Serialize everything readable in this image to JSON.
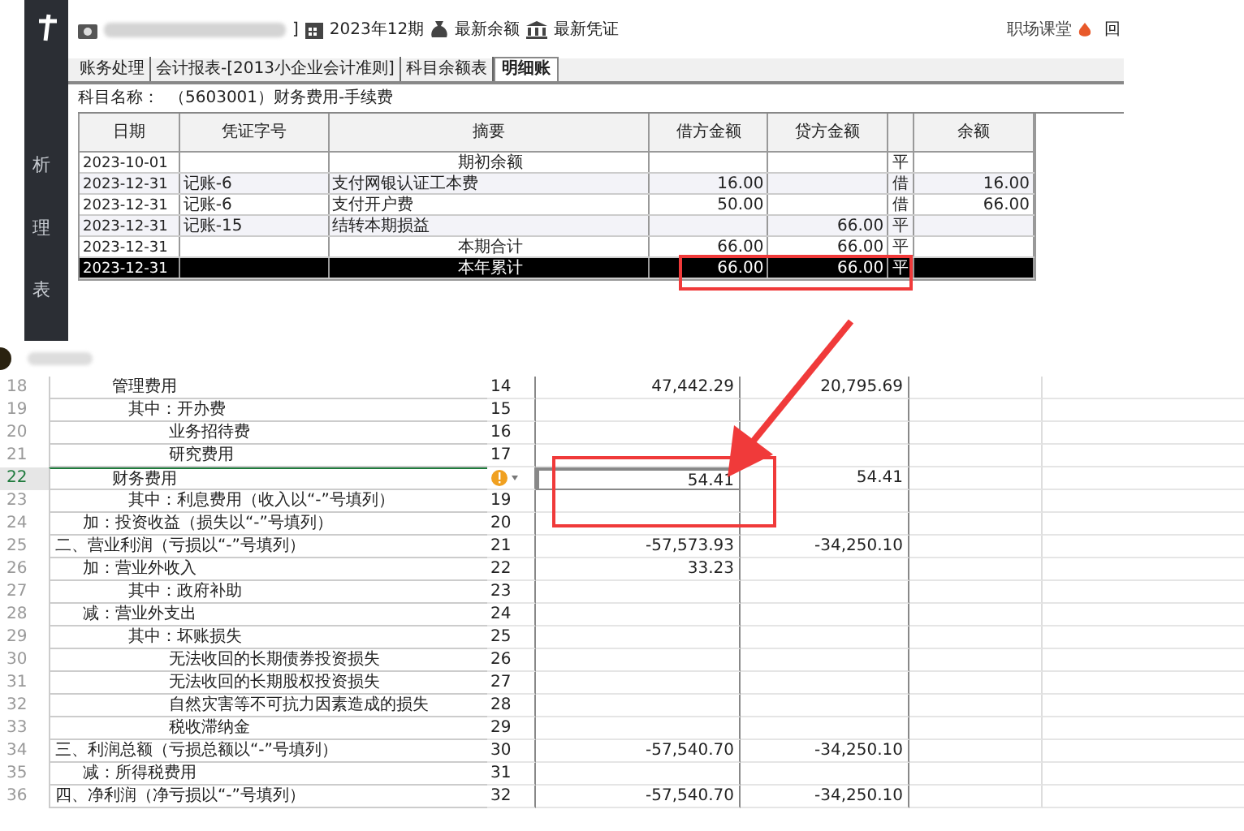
{
  "top_app": {
    "toolbar": {
      "bracket": "]",
      "period": "2023年12期",
      "latest_balance": "最新余额",
      "latest_voucher": "最新凭证",
      "brand": "职场课堂",
      "cut_text": "回"
    },
    "sidebar": {
      "items": [
        "析",
        "理",
        "表"
      ]
    },
    "tabs": [
      {
        "label": "账务处理",
        "selected": false
      },
      {
        "label": "会计报表-[2013小企业会计准则]",
        "selected": false
      },
      {
        "label": "科目余额表",
        "selected": false
      },
      {
        "label": "明细账",
        "selected": true
      }
    ],
    "subject": {
      "label": "科目名称：",
      "value": "（5603001）财务费用-手续费"
    },
    "table": {
      "columns": [
        "日期",
        "凭证字号",
        "摘要",
        "借方金额",
        "贷方金额",
        "余额"
      ],
      "rows": [
        {
          "kind": "total",
          "date": "2023-10-01",
          "summary": "期初余额",
          "direction": "平",
          "selected": false
        },
        {
          "kind": "entry",
          "date": "2023-12-31",
          "voucher": "记账-6",
          "summary": "支付网银认证工本费",
          "debit": "16.00",
          "direction": "借",
          "balance": "16.00",
          "selected": false
        },
        {
          "kind": "entry",
          "date": "2023-12-31",
          "voucher": "记账-6",
          "summary": "支付开户费",
          "debit": "50.00",
          "direction": "借",
          "balance": "66.00",
          "selected": false
        },
        {
          "kind": "entry",
          "date": "2023-12-31",
          "voucher": "记账-15",
          "summary": "结转本期损益",
          "credit": "66.00",
          "direction": "平",
          "selected": false
        },
        {
          "kind": "total",
          "date": "2023-12-31",
          "summary": "本期合计",
          "debit": "66.00",
          "credit": "66.00",
          "direction": "平",
          "selected": false
        },
        {
          "kind": "total",
          "date": "2023-12-31",
          "summary": "本年累计",
          "debit": "66.00",
          "credit": "66.00",
          "direction": "平",
          "selected": true
        }
      ]
    }
  },
  "sheet": {
    "rows": [
      {
        "row": "18",
        "label": "管理费用",
        "kind": "item",
        "line": "14",
        "col1": "47,442.29",
        "col2": "20,795.69",
        "selected": false,
        "warning": false
      },
      {
        "row": "19",
        "label": "其中：开办费",
        "kind": "sub",
        "line": "15",
        "selected": false,
        "warning": false
      },
      {
        "row": "20",
        "label": "业务招待费",
        "kind": "detail",
        "line": "16",
        "selected": false,
        "warning": false
      },
      {
        "row": "21",
        "label": "研究费用",
        "kind": "detail",
        "line": "17",
        "selected": false,
        "warning": false
      },
      {
        "row": "22",
        "label": "财务费用",
        "kind": "item",
        "col1": "54.41",
        "col2": "54.41",
        "selected": true,
        "warning": true
      },
      {
        "row": "23",
        "label": "其中：利息费用（收入以“-”号填列）",
        "kind": "sub",
        "line": "19",
        "selected": false,
        "warning": false
      },
      {
        "row": "24",
        "label": "加：投资收益（损失以“-”号填列）",
        "kind": "add",
        "line": "20",
        "selected": false,
        "warning": false
      },
      {
        "row": "25",
        "label": "二、营业利润（亏损以“-”号填列）",
        "kind": "heading",
        "line": "21",
        "col1": "-57,573.93",
        "col2": "-34,250.10",
        "selected": false,
        "warning": false
      },
      {
        "row": "26",
        "label": "加：营业外收入",
        "kind": "add",
        "line": "22",
        "col1": "33.23",
        "selected": false,
        "warning": false
      },
      {
        "row": "27",
        "label": "其中：政府补助",
        "kind": "sub",
        "line": "23",
        "selected": false,
        "warning": false
      },
      {
        "row": "28",
        "label": "减：营业外支出",
        "kind": "add",
        "line": "24",
        "selected": false,
        "warning": false
      },
      {
        "row": "29",
        "label": "其中：坏账损失",
        "kind": "sub",
        "line": "25",
        "selected": false,
        "warning": false
      },
      {
        "row": "30",
        "label": "无法收回的长期债券投资损失",
        "kind": "detail",
        "line": "26",
        "selected": false,
        "warning": false
      },
      {
        "row": "31",
        "label": "无法收回的长期股权投资损失",
        "kind": "detail",
        "line": "27",
        "selected": false,
        "warning": false
      },
      {
        "row": "32",
        "label": "自然灾害等不可抗力因素造成的损失",
        "kind": "detail",
        "line": "28",
        "selected": false,
        "warning": false
      },
      {
        "row": "33",
        "label": "税收滞纳金",
        "kind": "detail",
        "line": "29",
        "selected": false,
        "warning": false
      },
      {
        "row": "34",
        "label": "三、利润总额（亏损总额以“-”号填列）",
        "kind": "heading",
        "line": "30",
        "col1": "-57,540.70",
        "col2": "-34,250.10",
        "selected": false,
        "warning": false
      },
      {
        "row": "35",
        "label": "减：所得税费用",
        "kind": "add",
        "line": "31",
        "selected": false,
        "warning": false
      },
      {
        "row": "36",
        "label": "四、净利润（净亏损以“-”号填列）",
        "kind": "heading",
        "line": "32",
        "col1": "-57,540.70",
        "col2": "-34,250.10",
        "selected": false,
        "warning": false
      }
    ]
  }
}
